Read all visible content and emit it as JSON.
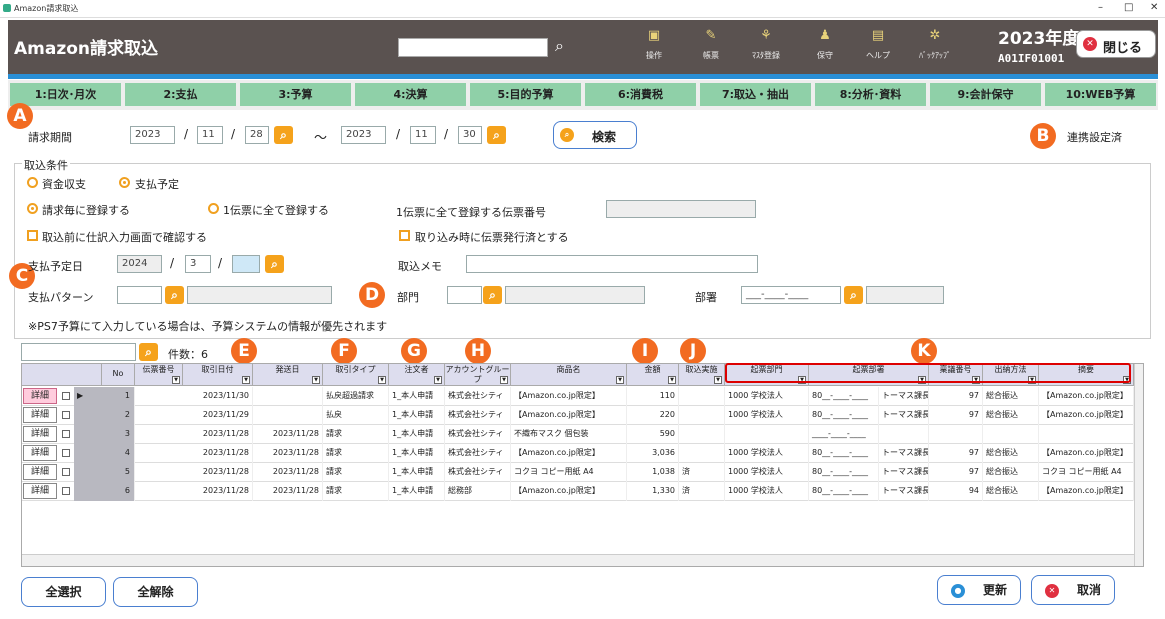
{
  "window": {
    "title": "Amazon請求取込",
    "minimize": "–",
    "maximize": "□",
    "close": "✕"
  },
  "header": {
    "title": "Amazon請求取込",
    "fiscal_year": "2023年度",
    "screen_code": "A01IF01001",
    "close_label": "閉じる",
    "buttons": [
      {
        "label": "操作",
        "icon": "operation-icon"
      },
      {
        "label": "帳票",
        "icon": "report-icon"
      },
      {
        "label": "ﾏｽﾀ登録",
        "icon": "master-icon"
      },
      {
        "label": "保守",
        "icon": "maintenance-icon"
      },
      {
        "label": "ヘルプ",
        "icon": "help-icon"
      },
      {
        "label": "ﾊﾞｯｸｱｯﾌﾟ",
        "icon": "backup-icon"
      }
    ]
  },
  "tabs": [
    "1:日次･月次",
    "2:支払",
    "3:予算",
    "4:決算",
    "5:目的予算",
    "6:消費税",
    "7:取込・抽出",
    "8:分析･資料",
    "9:会計保守",
    "10:WEB予算"
  ],
  "markers": [
    "A",
    "B",
    "C",
    "D",
    "E",
    "F",
    "G",
    "H",
    "I",
    "J",
    "K"
  ],
  "period": {
    "label": "請求期間",
    "from": {
      "year": "2023",
      "month": "11",
      "day": "28"
    },
    "tilde": "～",
    "to": {
      "year": "2023",
      "month": "11",
      "day": "30"
    },
    "sep": "/",
    "search_label": "検索",
    "linked_status": "連携設定済"
  },
  "conditions": {
    "legend": "取込条件",
    "radio1": [
      {
        "label": "資金収支",
        "checked": false
      },
      {
        "label": "支払予定",
        "checked": true
      }
    ],
    "radio2": [
      {
        "label": "請求毎に登録する",
        "checked": true
      },
      {
        "label": "1伝票に全て登録する",
        "checked": false
      }
    ],
    "batch_voucher_label": "1伝票に全て登録する伝票番号",
    "check1": "取込前に仕訳入力画面で確認する",
    "check2": "取り込み時に伝票発行済とする",
    "pay_date_label": "支払予定日",
    "pay_year": "2024",
    "pay_month": "3",
    "memo_label": "取込メモ",
    "pattern_label": "支払パターン",
    "dept_label": "部門",
    "section_label": "部署",
    "section_value": "___-____-____",
    "note": "※PS7予算にて入力している場合は、予算システムの情報が優先されます"
  },
  "list": {
    "count_label": "件数：6",
    "columns": [
      "No",
      "伝票番号",
      "取引日付",
      "発送日",
      "取引タイプ",
      "注文者",
      "アカウントグループ",
      "商品名",
      "金額",
      "取込実施",
      "起票部門",
      "起票部署",
      "稟議番号",
      "出納方法",
      "摘要"
    ],
    "detail_label": "詳細",
    "rows": [
      {
        "no": "1",
        "date": "2023/11/30",
        "ship": "",
        "type": "払戻超過請求",
        "orderer": "1_本人申請",
        "group": "株式会社シティ",
        "product": "【Amazon.co.jp限定】",
        "amount": "110",
        "done": "",
        "dept": "1000 学校法人",
        "section": "80__-____-____",
        "section_name": "トーマス課長",
        "ringi": "97",
        "method": "総合振込",
        "memo": "【Amazon.co.jp限定】"
      },
      {
        "no": "2",
        "date": "2023/11/29",
        "ship": "",
        "type": "払戻",
        "orderer": "1_本人申請",
        "group": "株式会社シティ",
        "product": "【Amazon.co.jp限定】",
        "amount": "220",
        "done": "",
        "dept": "1000 学校法人",
        "section": "80__-____-____",
        "section_name": "トーマス課長",
        "ringi": "97",
        "method": "総合振込",
        "memo": "【Amazon.co.jp限定】"
      },
      {
        "no": "3",
        "date": "2023/11/28",
        "ship": "2023/11/28",
        "type": "請求",
        "orderer": "1_本人申請",
        "group": "株式会社シティ",
        "product": "不織布マスク 個包装",
        "amount": "590",
        "done": "",
        "dept": "",
        "section": "____-____-____",
        "section_name": "",
        "ringi": "",
        "method": "",
        "memo": ""
      },
      {
        "no": "4",
        "date": "2023/11/28",
        "ship": "2023/11/28",
        "type": "請求",
        "orderer": "1_本人申請",
        "group": "株式会社シティ",
        "product": "【Amazon.co.jp限定】",
        "amount": "3,036",
        "done": "",
        "dept": "1000 学校法人",
        "section": "80__-____-____",
        "section_name": "トーマス課長",
        "ringi": "97",
        "method": "総合振込",
        "memo": "【Amazon.co.jp限定】"
      },
      {
        "no": "5",
        "date": "2023/11/28",
        "ship": "2023/11/28",
        "type": "請求",
        "orderer": "1_本人申請",
        "group": "株式会社シティ",
        "product": "コクヨ コピー用紙 A4",
        "amount": "1,038",
        "done": "済",
        "dept": "1000 学校法人",
        "section": "80__-____-____",
        "section_name": "トーマス課長",
        "ringi": "97",
        "method": "総合振込",
        "memo": "コクヨ コピー用紙 A4"
      },
      {
        "no": "6",
        "date": "2023/11/28",
        "ship": "2023/11/28",
        "type": "請求",
        "orderer": "1_本人申請",
        "group": "総務部",
        "product": "【Amazon.co.jp限定】",
        "amount": "1,330",
        "done": "済",
        "dept": "1000 学校法人",
        "section": "80__-____-____",
        "section_name": "トーマス課長",
        "ringi": "94",
        "method": "総合振込",
        "memo": "【Amazon.co.jp限定】"
      }
    ]
  },
  "footer": {
    "select_all": "全選択",
    "deselect_all": "全解除",
    "update": "更新",
    "cancel": "取消"
  }
}
